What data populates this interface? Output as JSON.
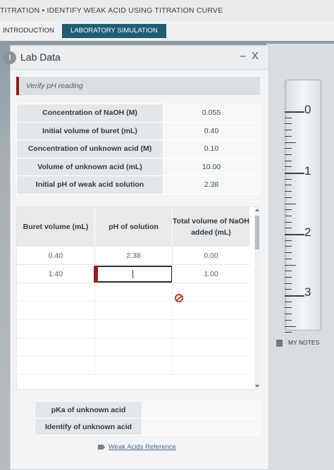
{
  "header": {
    "title": "TITRATION • IDENTIFY WEAK ACID USING TITRATION CURVE"
  },
  "tabs": [
    {
      "label": "INTRODUCTION"
    },
    {
      "label": "LABORATORY SIMULATION"
    }
  ],
  "window": {
    "title": "Lab Data",
    "controls": "– X",
    "status": "Verify pH reading"
  },
  "lab_info": [
    {
      "label": "Concentration of NaOH (M)",
      "value": "0.055"
    },
    {
      "label": "Initial volume of buret (mL)",
      "value": "0.40"
    },
    {
      "label": "Concentration of unknown acid (M)",
      "value": "0.10"
    },
    {
      "label": "Volume of unknown acid (mL)",
      "value": "10.00"
    },
    {
      "label": "Initial pH of weak acid solution",
      "value": "2.38"
    }
  ],
  "data_table": {
    "headers": [
      "Buret volume (mL)",
      "pH of solution",
      "Total volume of NaOH added (mL)"
    ],
    "rows": [
      {
        "buret": "0.40",
        "ph": "2.38",
        "total": "0.00"
      },
      {
        "buret": "1.40",
        "ph": "",
        "total": "1.00"
      }
    ]
  },
  "results": [
    {
      "label": "pKa of unknown acid",
      "value": ""
    },
    {
      "label": "Identify of unknown acid",
      "value": ""
    }
  ],
  "reference_link": "Weak Acids Reference",
  "buret_scale": [
    "0",
    "1",
    "2",
    "3"
  ],
  "notes_label": "MY NOTES",
  "colors": {
    "accent_tab": "#1f5d74",
    "status_flag": "#8b1f1f",
    "error": "#c0392b"
  }
}
